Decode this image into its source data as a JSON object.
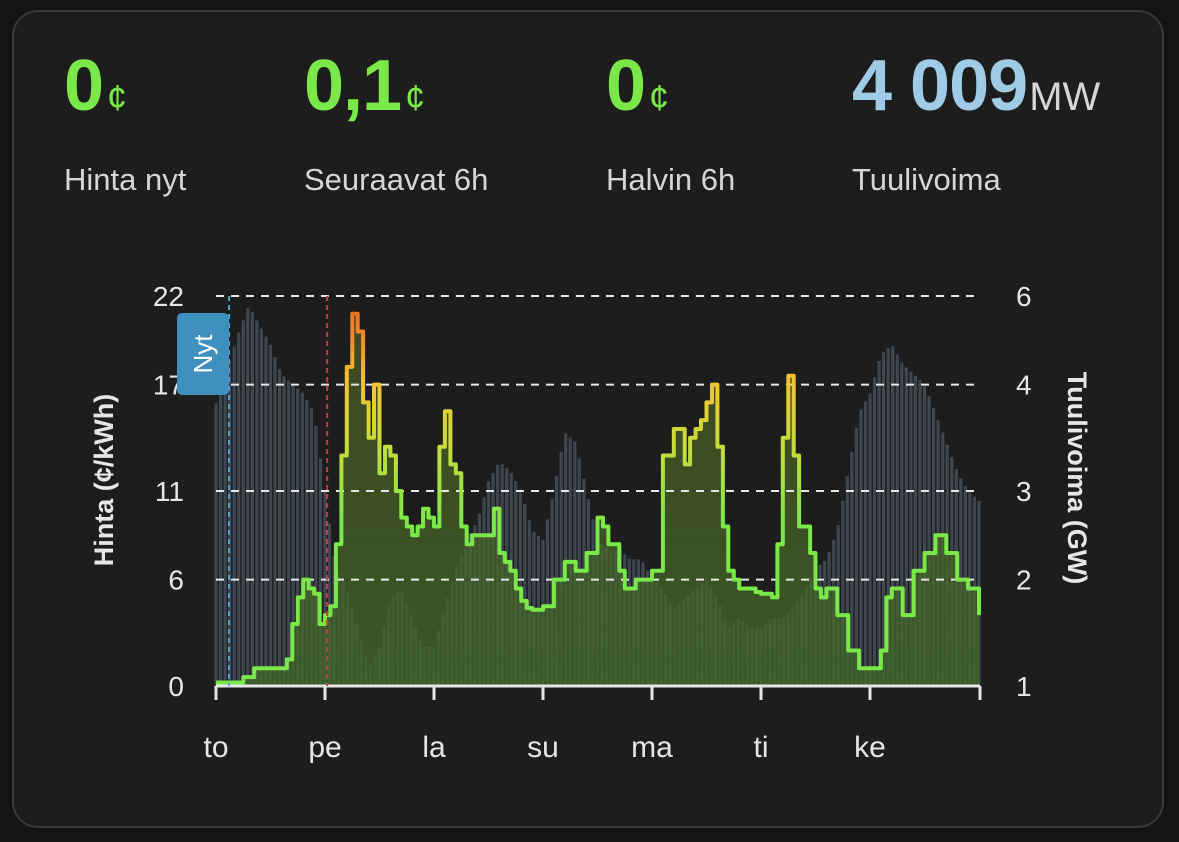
{
  "colors": {
    "price_green": "#7be84a",
    "wind_blue": "#9fcbe6",
    "now_badge": "#3f8fbf"
  },
  "stats": [
    {
      "value": "0",
      "unit": "¢",
      "label": "Hinta nyt",
      "color": "#7be84a"
    },
    {
      "value": "0,1",
      "unit": "¢",
      "label": "Seuraavat 6h",
      "color": "#7be84a"
    },
    {
      "value": "0",
      "unit": "¢",
      "label": "Halvin 6h",
      "color": "#7be84a"
    },
    {
      "value": "4 009",
      "unit": "MW",
      "label": "Tuulivoima",
      "color": "#9fcbe6"
    }
  ],
  "chart_data": {
    "type": "line",
    "y_left_label": "Hinta (¢/kWh)",
    "y_right_label": "Tuulivoima (GW)",
    "y_left_ticks": [
      "0",
      "6",
      "11",
      "17",
      "22"
    ],
    "y_left_range": [
      0,
      22
    ],
    "y_right_ticks": [
      "1",
      "2",
      "3",
      "4",
      "6"
    ],
    "y_right_range": [
      1,
      5
    ],
    "x_day_labels": [
      "to",
      "pe",
      "la",
      "su",
      "ma",
      "ti",
      "ke"
    ],
    "now_label": "Nyt",
    "now_day_position": 0.12,
    "price_forecast_start_day": 1.02,
    "grid": true,
    "series": [
      {
        "name": "Hinta (¢/kWh)",
        "type": "line",
        "x_day": [
          0.0,
          0.25,
          0.35,
          0.5,
          0.65,
          0.7,
          0.75,
          0.8,
          0.85,
          0.9,
          0.95,
          1.0,
          1.05,
          1.1,
          1.15,
          1.2,
          1.25,
          1.3,
          1.35,
          1.4,
          1.45,
          1.5,
          1.55,
          1.6,
          1.65,
          1.7,
          1.75,
          1.8,
          1.85,
          1.9,
          1.95,
          2.0,
          2.05,
          2.1,
          2.15,
          2.2,
          2.25,
          2.3,
          2.35,
          2.4,
          2.45,
          2.5,
          2.55,
          2.6,
          2.65,
          2.7,
          2.75,
          2.8,
          2.85,
          2.9,
          2.95,
          3.0,
          3.1,
          3.2,
          3.3,
          3.4,
          3.5,
          3.55,
          3.6,
          3.7,
          3.75,
          3.8,
          3.85,
          3.9,
          4.0,
          4.1,
          4.2,
          4.3,
          4.35,
          4.4,
          4.45,
          4.5,
          4.55,
          4.6,
          4.65,
          4.7,
          4.75,
          4.8,
          4.85,
          4.9,
          4.95,
          5.0,
          5.1,
          5.15,
          5.2,
          5.25,
          5.3,
          5.35,
          5.4,
          5.45,
          5.5,
          5.55,
          5.6,
          5.65,
          5.7,
          5.8,
          5.9,
          6.0,
          6.1,
          6.15,
          6.2,
          6.3,
          6.4,
          6.5,
          6.6,
          6.7,
          6.8,
          6.9,
          7.0
        ],
        "values": [
          0.2,
          0.5,
          1.0,
          1.0,
          1.5,
          3.5,
          5.0,
          6.0,
          5.5,
          5.2,
          3.5,
          4.0,
          4.5,
          8.0,
          13.0,
          18.0,
          21.0,
          20.0,
          16.0,
          14.0,
          17.0,
          12.0,
          13.5,
          13.0,
          11.0,
          9.5,
          9.0,
          8.5,
          9.0,
          10.0,
          9.5,
          9.0,
          13.5,
          15.5,
          12.5,
          12.0,
          9.0,
          8.0,
          8.5,
          8.5,
          8.5,
          8.5,
          10.0,
          7.5,
          7.0,
          6.5,
          5.5,
          4.8,
          4.4,
          4.3,
          4.3,
          4.5,
          6.0,
          7.0,
          6.5,
          7.5,
          9.5,
          9.0,
          8.0,
          6.5,
          5.5,
          5.5,
          6.0,
          6.0,
          6.5,
          13.0,
          14.5,
          12.5,
          14.0,
          14.5,
          15.0,
          16.0,
          17.0,
          13.5,
          9.0,
          6.5,
          6.0,
          5.5,
          5.5,
          5.5,
          5.3,
          5.2,
          5.0,
          8.0,
          14.0,
          17.5,
          13.0,
          9.0,
          9.0,
          7.5,
          5.5,
          5.0,
          5.5,
          5.5,
          4.0,
          2.0,
          1.0,
          1.0,
          2.0,
          5.0,
          5.5,
          4.0,
          6.5,
          7.5,
          8.5,
          7.5,
          6.0,
          5.5,
          4.0
        ],
        "color": "#7be84a"
      },
      {
        "name": "Tuulivoima (GW)",
        "type": "bar",
        "x_day": [
          0.0,
          0.2,
          0.3,
          0.4,
          0.5,
          0.6,
          0.7,
          0.8,
          0.9,
          1.0,
          1.1,
          1.2,
          1.3,
          1.4,
          1.5,
          1.6,
          1.7,
          1.8,
          1.9,
          2.0,
          2.1,
          2.2,
          2.3,
          2.4,
          2.5,
          2.6,
          2.7,
          2.8,
          2.9,
          3.0,
          3.1,
          3.2,
          3.3,
          3.4,
          3.5,
          3.6,
          3.7,
          3.8,
          3.9,
          4.0,
          4.1,
          4.2,
          4.3,
          4.4,
          4.5,
          4.6,
          4.7,
          4.8,
          4.9,
          5.0,
          5.1,
          5.2,
          5.3,
          5.4,
          5.5,
          5.6,
          5.7,
          5.8,
          5.9,
          6.0,
          6.1,
          6.2,
          6.3,
          6.4,
          6.5,
          6.6,
          6.7,
          6.8,
          6.9,
          7.0
        ],
        "values": [
          3.9,
          4.6,
          4.9,
          4.7,
          4.5,
          4.2,
          4.1,
          4.0,
          3.8,
          3.0,
          2.2,
          2.0,
          1.6,
          1.2,
          1.4,
          1.9,
          2.0,
          1.7,
          1.4,
          1.4,
          1.8,
          2.2,
          2.5,
          2.7,
          3.1,
          3.3,
          3.2,
          3.0,
          2.6,
          2.5,
          3.0,
          3.6,
          3.5,
          3.0,
          2.5,
          2.4,
          2.4,
          2.3,
          2.3,
          2.1,
          2.0,
          1.8,
          1.9,
          2.0,
          2.1,
          1.9,
          1.6,
          1.7,
          1.6,
          1.6,
          1.7,
          1.7,
          1.8,
          2.0,
          2.2,
          2.3,
          2.6,
          3.2,
          3.8,
          4.0,
          4.4,
          4.5,
          4.3,
          4.2,
          4.1,
          3.8,
          3.5,
          3.2,
          3.0,
          2.9
        ],
        "color": "#5f7080"
      }
    ]
  }
}
